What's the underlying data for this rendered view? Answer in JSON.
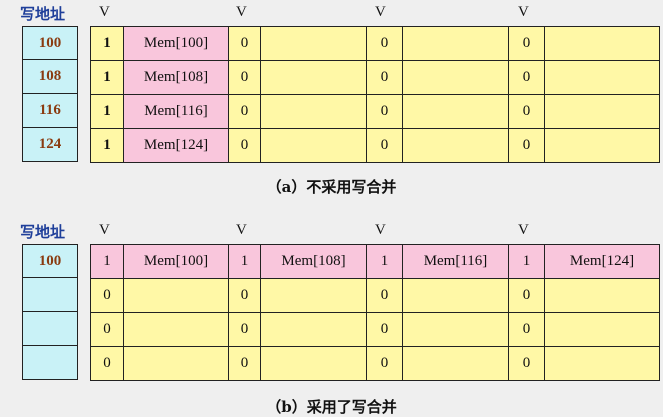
{
  "common": {
    "addr_title": "写地址",
    "v_label": "V"
  },
  "fig_a": {
    "caption": "（a）不采用写合并",
    "rows": [
      {
        "addr": "100",
        "blocks": [
          {
            "v": "1",
            "data": "Mem[100]"
          },
          {
            "v": "0",
            "data": ""
          },
          {
            "v": "0",
            "data": ""
          },
          {
            "v": "0",
            "data": ""
          }
        ]
      },
      {
        "addr": "108",
        "blocks": [
          {
            "v": "1",
            "data": "Mem[108]"
          },
          {
            "v": "0",
            "data": ""
          },
          {
            "v": "0",
            "data": ""
          },
          {
            "v": "0",
            "data": ""
          }
        ]
      },
      {
        "addr": "116",
        "blocks": [
          {
            "v": "1",
            "data": "Mem[116]"
          },
          {
            "v": "0",
            "data": ""
          },
          {
            "v": "0",
            "data": ""
          },
          {
            "v": "0",
            "data": ""
          }
        ]
      },
      {
        "addr": "124",
        "blocks": [
          {
            "v": "1",
            "data": "Mem[124]"
          },
          {
            "v": "0",
            "data": ""
          },
          {
            "v": "0",
            "data": ""
          },
          {
            "v": "0",
            "data": ""
          }
        ]
      }
    ]
  },
  "fig_b": {
    "caption": "（b）采用了写合并",
    "rows": [
      {
        "addr": "100",
        "blocks": [
          {
            "v": "1",
            "data": "Mem[100]"
          },
          {
            "v": "1",
            "data": "Mem[108]"
          },
          {
            "v": "1",
            "data": "Mem[116]"
          },
          {
            "v": "1",
            "data": "Mem[124]"
          }
        ]
      },
      {
        "addr": "",
        "blocks": [
          {
            "v": "0",
            "data": ""
          },
          {
            "v": "0",
            "data": ""
          },
          {
            "v": "0",
            "data": ""
          },
          {
            "v": "0",
            "data": ""
          }
        ]
      },
      {
        "addr": "",
        "blocks": [
          {
            "v": "0",
            "data": ""
          },
          {
            "v": "0",
            "data": ""
          },
          {
            "v": "0",
            "data": ""
          },
          {
            "v": "0",
            "data": ""
          }
        ]
      },
      {
        "addr": "",
        "blocks": [
          {
            "v": "0",
            "data": ""
          },
          {
            "v": "0",
            "data": ""
          },
          {
            "v": "0",
            "data": ""
          },
          {
            "v": "0",
            "data": ""
          }
        ]
      }
    ]
  }
}
